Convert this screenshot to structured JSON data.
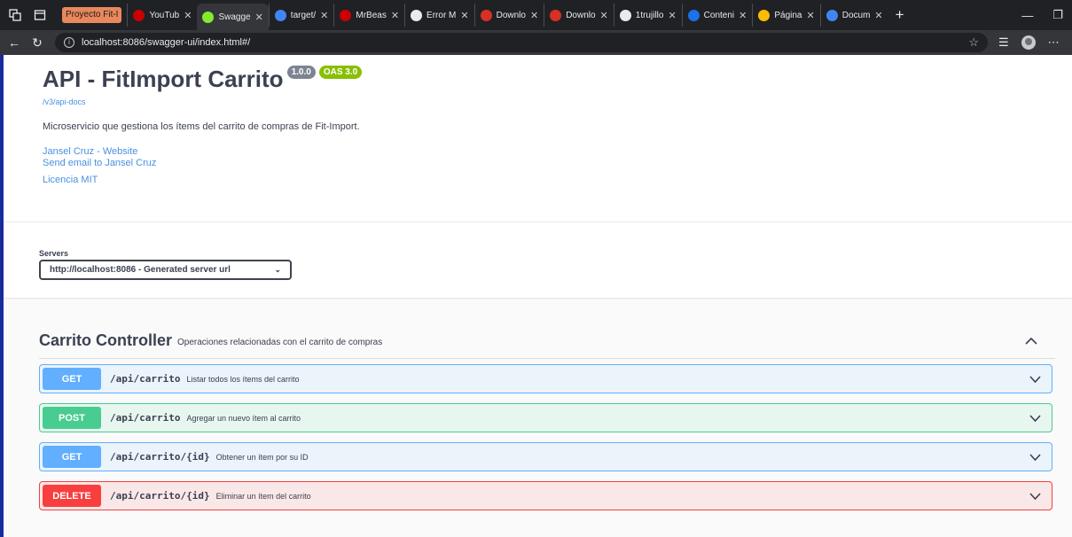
{
  "browser": {
    "group_label": "Proyecto Fit-I",
    "tabs": [
      {
        "label": "YouTub",
        "color": "#cc0000"
      },
      {
        "label": "Swagge",
        "color": "#85ea2d",
        "active": true
      },
      {
        "label": "target/",
        "color": "#4285f4"
      },
      {
        "label": "MrBeas",
        "color": "#cc0000"
      },
      {
        "label": "Error M",
        "color": "#e8eaed"
      },
      {
        "label": "Downlo",
        "color": "#d93025"
      },
      {
        "label": "Downlo",
        "color": "#d93025"
      },
      {
        "label": "1trujillo",
        "color": "#e8eaed"
      },
      {
        "label": "Conteni",
        "color": "#1a73e8"
      },
      {
        "label": "Página",
        "color": "#fbbc04"
      },
      {
        "label": "Docum",
        "color": "#4285f4"
      }
    ],
    "url": "localhost:8086/swagger-ui/index.html#/"
  },
  "api": {
    "title": "API - FitImport Carrito",
    "version": "1.0.0",
    "oas": "OAS 3.0",
    "docs_link": "/v3/api-docs",
    "description": "Microservicio que gestiona los ítems del carrito de compras de Fit-Import.",
    "contact_website": "Jansel Cruz - Website",
    "contact_email": "Send email to Jansel Cruz",
    "license": "Licencia MIT"
  },
  "servers": {
    "label": "Servers",
    "selected": "http://localhost:8086 - Generated server url"
  },
  "controller": {
    "name": "Carrito Controller",
    "description": "Operaciones relacionadas con el carrito de compras",
    "operations": [
      {
        "method": "GET",
        "path": "/api/carrito",
        "summary": "Listar todos los ítems del carrito"
      },
      {
        "method": "POST",
        "path": "/api/carrito",
        "summary": "Agregar un nuevo ítem al carrito"
      },
      {
        "method": "GET",
        "path": "/api/carrito/{id}",
        "summary": "Obtener un ítem por su ID"
      },
      {
        "method": "DELETE",
        "path": "/api/carrito/{id}",
        "summary": "Eliminar un ítem del carrito"
      }
    ]
  }
}
